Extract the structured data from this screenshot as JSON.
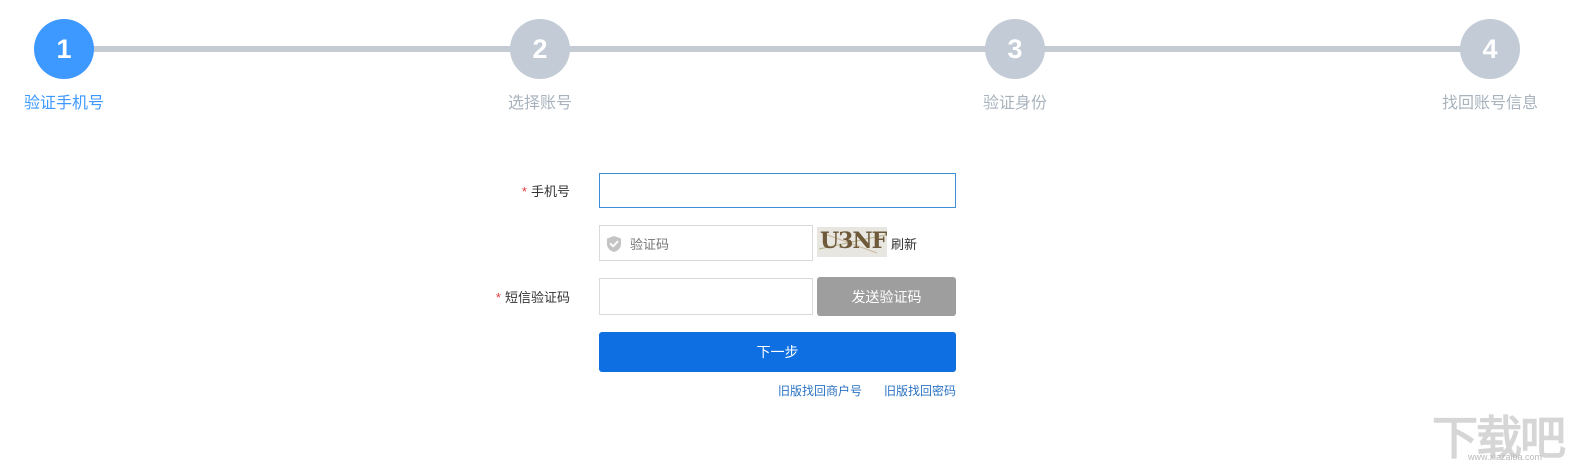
{
  "steps": [
    {
      "number": "1",
      "label": "验证手机号",
      "active": true
    },
    {
      "number": "2",
      "label": "选择账号",
      "active": false
    },
    {
      "number": "3",
      "label": "验证身份",
      "active": false
    },
    {
      "number": "4",
      "label": "找回账号信息",
      "active": false
    }
  ],
  "form": {
    "phone_label": "手机号",
    "phone_value": "",
    "captcha_placeholder": "验证码",
    "captcha_text": "U3NF",
    "refresh_label": "刷新",
    "sms_label": "短信验证码",
    "sms_value": "",
    "send_code_label": "发送验证码",
    "next_label": "下一步",
    "required_mark": "*"
  },
  "links": {
    "old_find_merchant": "旧版找回商户号",
    "old_find_password": "旧版找回密码"
  },
  "watermark": {
    "text": "下载吧",
    "url": "www.xiazaiba.com"
  },
  "colors": {
    "active": "#3d98ff",
    "inactive": "#c2cbd6",
    "primary_button": "#0d6fe1",
    "disabled_button": "#9e9e9e",
    "link": "#2b72c2",
    "required": "#e4393c"
  }
}
